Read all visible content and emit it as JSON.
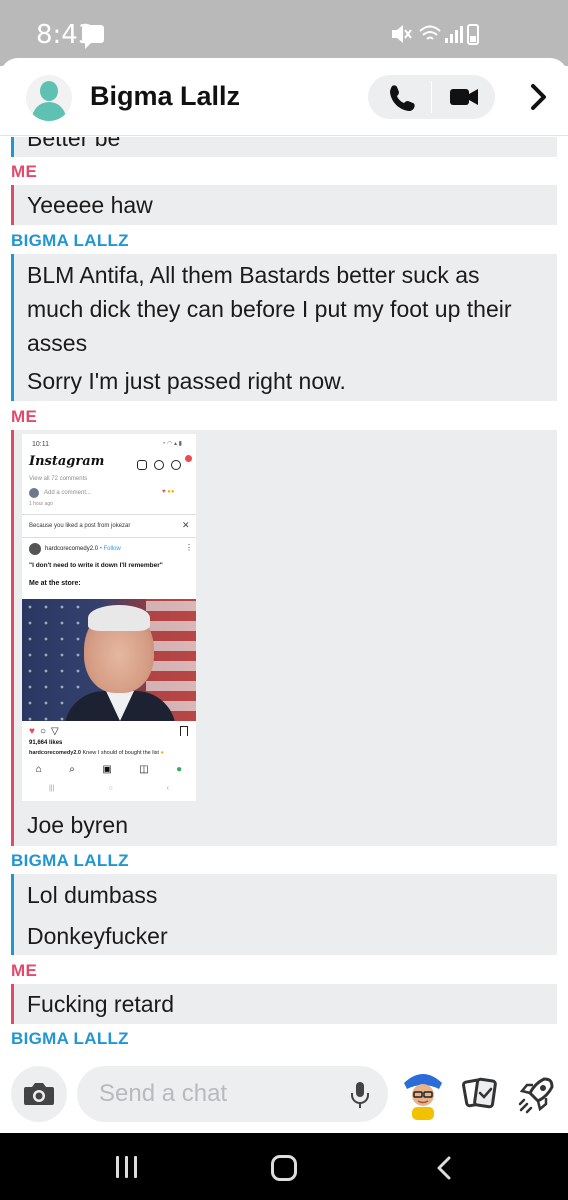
{
  "status_bar": {
    "time": "8:43",
    "icons": [
      "message-icon",
      "mute-icon",
      "wifi-icon",
      "signal-icon",
      "battery-icon"
    ]
  },
  "header": {
    "contact_name": "Bigma Lallz"
  },
  "chat": {
    "messages": [
      {
        "sender": "BIGMA LALLZ",
        "text": "Better be"
      },
      {
        "sender": "ME",
        "text": "Yeeeee haw"
      },
      {
        "sender": "BIGMA LALLZ",
        "text": "BLM Antifa, All them Bastards better suck as much dick they can before I put my foot up their asses"
      },
      {
        "sender": "BIGMA LALLZ",
        "text": "Sorry I'm just passed right now."
      },
      {
        "sender": "ME",
        "text": "Joe byren"
      },
      {
        "sender": "BIGMA LALLZ",
        "text": "Lol dumbass"
      },
      {
        "sender": "BIGMA LALLZ",
        "text": "Donkeyfucker"
      },
      {
        "sender": "ME",
        "text": "Fucking retard"
      }
    ],
    "sender_labels": {
      "me": "ME",
      "them": "BIGMA LALLZ"
    },
    "attached_screenshot": {
      "time": "10:11",
      "app_name": "Instagram",
      "badge_count": "1",
      "view_comments": "View all 72 comments",
      "add_comment": "Add a comment...",
      "comment_time": "1 hour ago",
      "suggestion": "Because you liked a post from jokezar",
      "account": "hardcorecomedy2.0",
      "follow": "• Follow",
      "quote": "\"I don't need to write it down I'll remember\"",
      "caption_head": "Me at the store:",
      "likes": "91,664 likes",
      "caption_user": "hardcorecomedy2.0",
      "caption_text": "Knew I should of bought the list"
    }
  },
  "composer": {
    "placeholder": "Send a chat"
  },
  "colors": {
    "me": "#e04b6b",
    "them": "#2196d2",
    "bubble": "#ecedef"
  }
}
